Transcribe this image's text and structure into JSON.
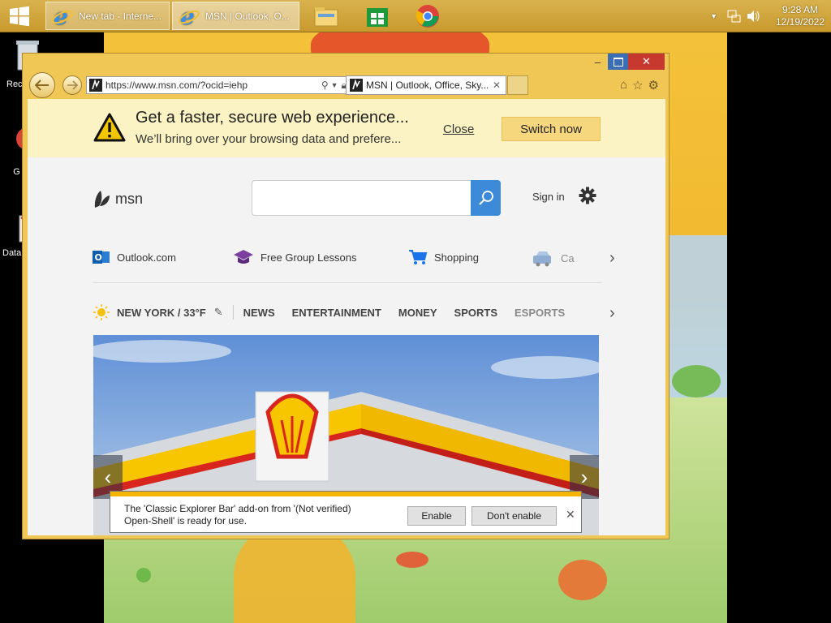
{
  "taskbar": {
    "tasks": [
      {
        "label": "New tab - Interne..."
      },
      {
        "label": "MSN | Outlook, O..."
      }
    ],
    "pinned": [
      "file-explorer-icon",
      "store-icon",
      "chrome-icon"
    ],
    "clock": {
      "time": "9:28 AM",
      "date": "12/19/2022"
    }
  },
  "desktop": {
    "icons": [
      {
        "label": "Rec"
      },
      {
        "label": "G C"
      },
      {
        "label": "Data"
      }
    ]
  },
  "browser": {
    "address": "https://www.msn.com/?ocid=iehp",
    "tab_title": "MSN | Outlook, Office, Sky...",
    "window_buttons": {
      "minimize": "–",
      "maximize": "□",
      "close": "✕"
    }
  },
  "notification": {
    "title": "Get a faster, secure web experience...",
    "subtitle": "We’ll bring over your browsing data and prefere...",
    "close_label": "Close",
    "switch_label": "Switch now"
  },
  "msn": {
    "logo_text": "msn",
    "search_placeholder": "",
    "signin_label": "Sign in",
    "quicklinks": [
      {
        "label": "Outlook.com",
        "icon": "outlook-icon"
      },
      {
        "label": "Free Group Lessons",
        "icon": "graduation-cap-icon"
      },
      {
        "label": "Shopping",
        "icon": "shopping-cart-icon"
      },
      {
        "label": "Ca",
        "icon": "car-icon"
      }
    ],
    "weather": "NEW YORK / 33°F",
    "nav": [
      "NEWS",
      "ENTERTAINMENT",
      "MONEY",
      "SPORTS",
      "ESPORTS"
    ]
  },
  "addon_bar": {
    "message_line1": "The 'Classic Explorer Bar' add-on from '(Not verified)",
    "message_line2": "Open-Shell' is ready for use.",
    "enable_label": "Enable",
    "dont_enable_label": "Don't enable",
    "close_symbol": "✕"
  },
  "colors": {
    "taskbar": "#c89a2e",
    "window_frame": "#f0c655",
    "notification_bg": "#fbf3c3",
    "switch_button": "#f6d77d",
    "search_button": "#3c8ad8",
    "close_button": "#c7382e",
    "shell_red": "#d8261f",
    "shell_yellow": "#f7c600"
  }
}
